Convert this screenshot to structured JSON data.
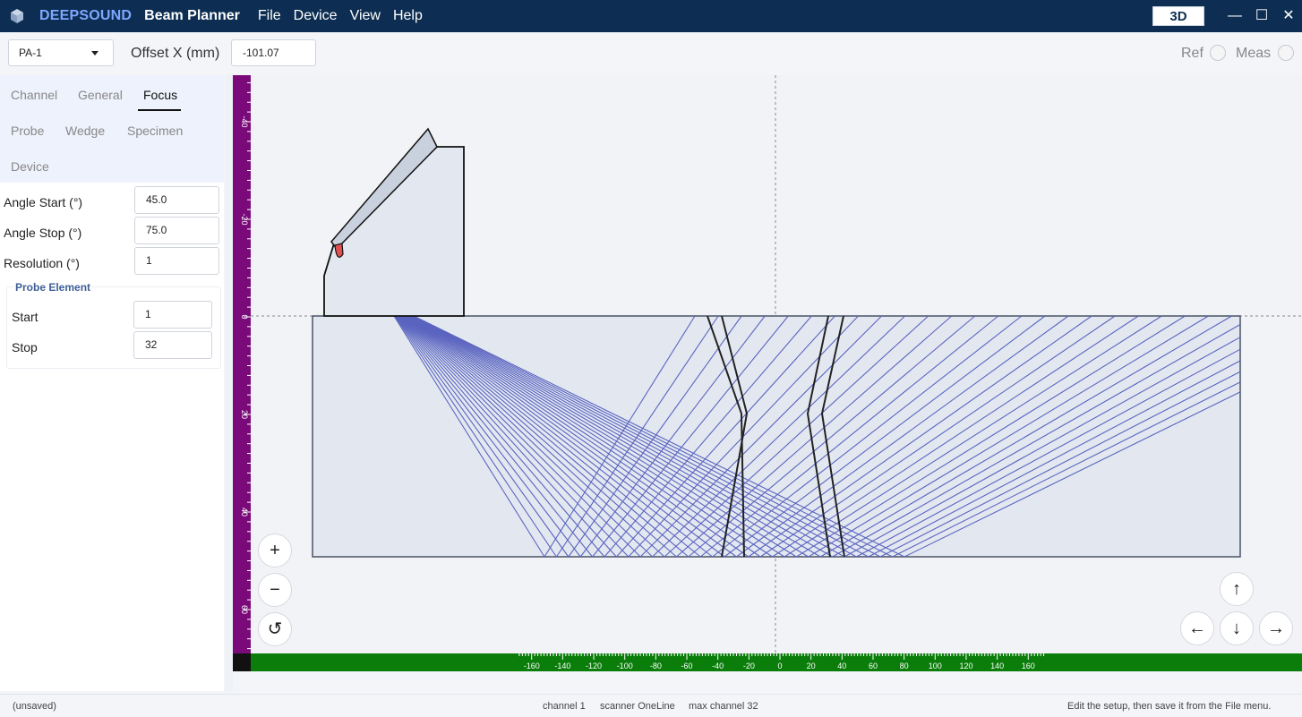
{
  "titlebar": {
    "brand": "DEEPSOUND",
    "app_title": "Beam Planner",
    "menu": [
      "File",
      "Device",
      "View",
      "Help"
    ],
    "view_3d": "3D",
    "minimize": "—",
    "maximize": "☐",
    "close": "✕"
  },
  "toolbar": {
    "channel_value": "PA-1",
    "offset_label": "Offset X (mm)",
    "offset_value": "-101.07",
    "ref_label": "Ref",
    "meas_label": "Meas"
  },
  "sidebar": {
    "tabs": [
      "Channel",
      "General",
      "Focus",
      "Probe",
      "Wedge",
      "Specimen",
      "Device"
    ],
    "active_tab": "Focus",
    "fields": [
      {
        "label": "Angle Start (°)",
        "value": "45.0"
      },
      {
        "label": "Angle Stop (°)",
        "value": "75.0"
      },
      {
        "label": "Resolution (°)",
        "value": "1"
      }
    ],
    "probe_element": {
      "title": "Probe Element",
      "fields": [
        {
          "label": "Start",
          "value": "1"
        },
        {
          "label": "Stop",
          "value": "32"
        }
      ]
    }
  },
  "canvas": {
    "zoom_in": "+",
    "zoom_out": "−",
    "reset": "↺",
    "pan_up": "↑",
    "pan_down": "↓",
    "pan_left": "←",
    "pan_right": "→",
    "x_ruler_labels": [
      "-160",
      "-140",
      "-120",
      "-100",
      "-80",
      "-60",
      "-40",
      "-20",
      "0",
      "20",
      "40",
      "60",
      "80",
      "100",
      "120",
      "140",
      "160"
    ],
    "y_ruler_labels": [
      "-40",
      "-20",
      "0",
      "20",
      "40",
      "60"
    ],
    "colors": {
      "beam": "#5a64c0",
      "ruler_x": "#0a7d0a",
      "ruler_y": "#7a0a7a",
      "specimen": "#e3e8f0",
      "weld": "#222222"
    }
  },
  "statusbar": {
    "saved_state": "(unsaved)",
    "channel": "channel 1",
    "scanner": "scanner OneLine",
    "max_channel": "max channel 32",
    "hint": "Edit the setup, then save it from the File menu."
  }
}
